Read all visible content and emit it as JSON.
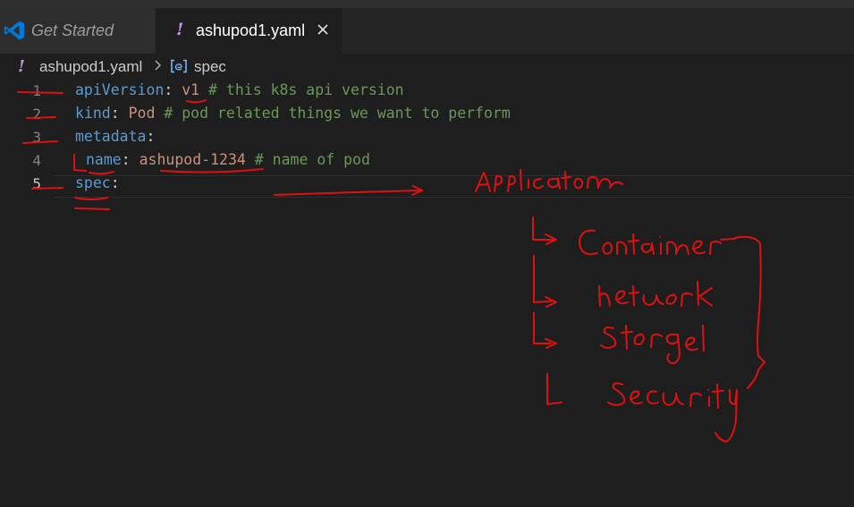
{
  "tabs": [
    {
      "label": "Get Started",
      "active": false
    },
    {
      "label": "ashupod1.yaml",
      "active": true
    }
  ],
  "tab_indicator": "!",
  "breadcrumb": {
    "indicator": "!",
    "file": "ashupod1.yaml",
    "symbol": "spec"
  },
  "lines": [
    {
      "number": "1",
      "key": "apiVersion",
      "sep": ": ",
      "value": "v1",
      "comment": " # this k8s api version"
    },
    {
      "number": "2",
      "key": "kind",
      "sep": ": ",
      "value": "Pod",
      "comment": " # pod related things we want to perform"
    },
    {
      "number": "3",
      "key": "metadata",
      "sep": ":",
      "value": "",
      "comment": ""
    },
    {
      "number": "4",
      "key": "name",
      "sep": ": ",
      "value": "ashupod-1234",
      "comment": " # name of pod"
    },
    {
      "number": "5",
      "key": "spec",
      "sep": ":",
      "value": "",
      "comment": ""
    }
  ],
  "colors": {
    "keyword": "#569cd6",
    "string": "#ce9178",
    "comment": "#6a9955",
    "ink": "#e01010",
    "vscode_blue": "#0078d7"
  },
  "icons": [
    "vscode-logo-icon",
    "close-icon",
    "chevron-right-icon",
    "symbol-object-icon"
  ]
}
